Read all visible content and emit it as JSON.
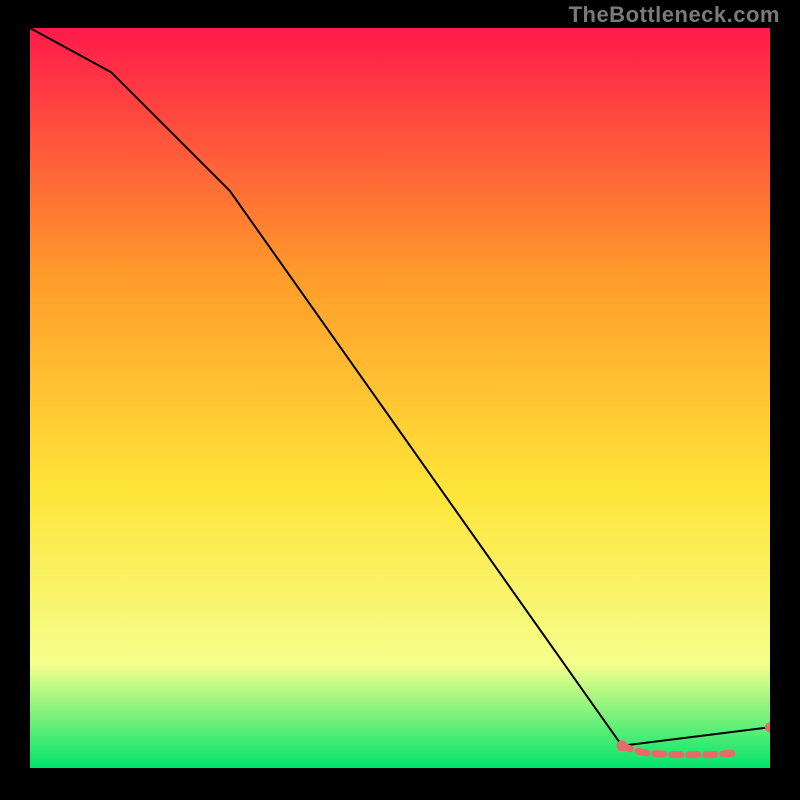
{
  "attribution": "TheBottleneck.com",
  "gradient": {
    "top_color": "#ff1a4b",
    "mid1_color": "#ff9a2a",
    "mid2_color": "#ffe438",
    "mid3_color": "#f5ff8c",
    "bottom_color": "#00e46a"
  },
  "curve_color": "#000000",
  "marker_color": "#e86a6a",
  "chart_data": {
    "type": "line",
    "title": "",
    "xlabel": "",
    "ylabel": "",
    "xlim": [
      0,
      100
    ],
    "ylim": [
      0,
      100
    ],
    "series": [
      {
        "name": "curve",
        "x": [
          0,
          11,
          27,
          80,
          100
        ],
        "y": [
          100,
          94,
          78,
          3,
          5.5
        ]
      },
      {
        "name": "markers",
        "x": [
          80,
          82,
          83.5,
          85,
          87.5,
          89,
          90.5,
          92,
          93.5,
          95,
          100
        ],
        "y": [
          3.0,
          2.3,
          2.0,
          1.9,
          1.8,
          1.8,
          1.8,
          1.8,
          1.9,
          2.0,
          5.5
        ]
      }
    ]
  }
}
